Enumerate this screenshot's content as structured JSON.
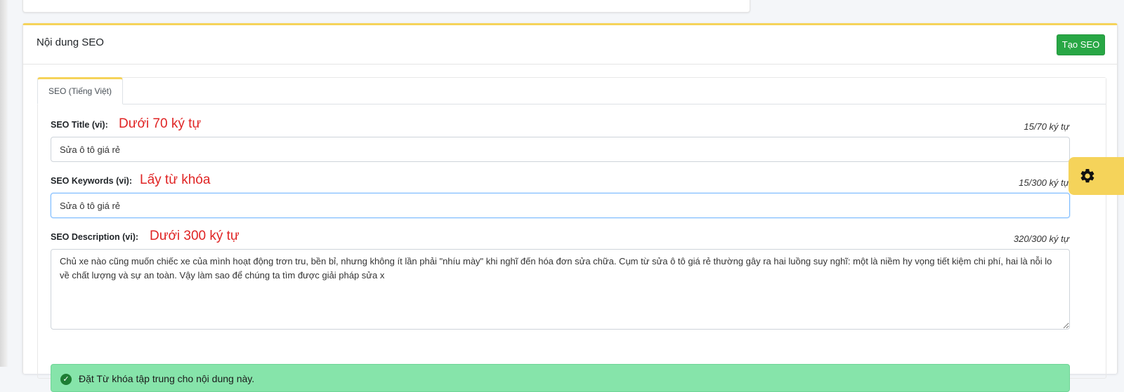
{
  "seo_card": {
    "title": "Nội dung SEO",
    "create_button": "Tạo SEO"
  },
  "tabs": [
    {
      "label": "SEO (Tiếng Việt)",
      "active": true
    }
  ],
  "fields": {
    "title": {
      "label": "SEO Title (vi):",
      "hint": "Dưới 70 ký tự",
      "count": "15/70 ký tự",
      "value": "Sửa ô tô giá rẻ"
    },
    "keywords": {
      "label": "SEO Keywords (vi):",
      "hint": "Lấy từ khóa",
      "count": "15/300 ký tự",
      "value": "Sửa ô tô giá rẻ"
    },
    "description": {
      "label": "SEO Description (vi):",
      "hint": "Dưới 300 ký tự",
      "count": "320/300 ký tự",
      "value": "Chủ xe nào cũng muốn chiếc xe của mình hoạt động trơn tru, bền bỉ, nhưng không ít lần phải \"nhíu mày\" khi nghĩ đến hóa đơn sửa chữa. Cụm từ sửa ô tô giá rẻ thường gây ra hai luồng suy nghĩ: một là niềm hy vọng tiết kiệm chi phí, hai là nỗi lo về chất lượng và sự an toàn. Vậy làm sao để chúng ta tìm được giải pháp sửa x"
    }
  },
  "alert": {
    "text": "Đặt Từ khóa tập trung cho nội dung này.",
    "icon": "check-circle-icon"
  },
  "settings": {
    "icon": "gear-icon"
  },
  "colors": {
    "accent": "#f5d35a",
    "success": "#28a745",
    "hint": "#e02424",
    "alert_bg": "#86e4aa"
  }
}
